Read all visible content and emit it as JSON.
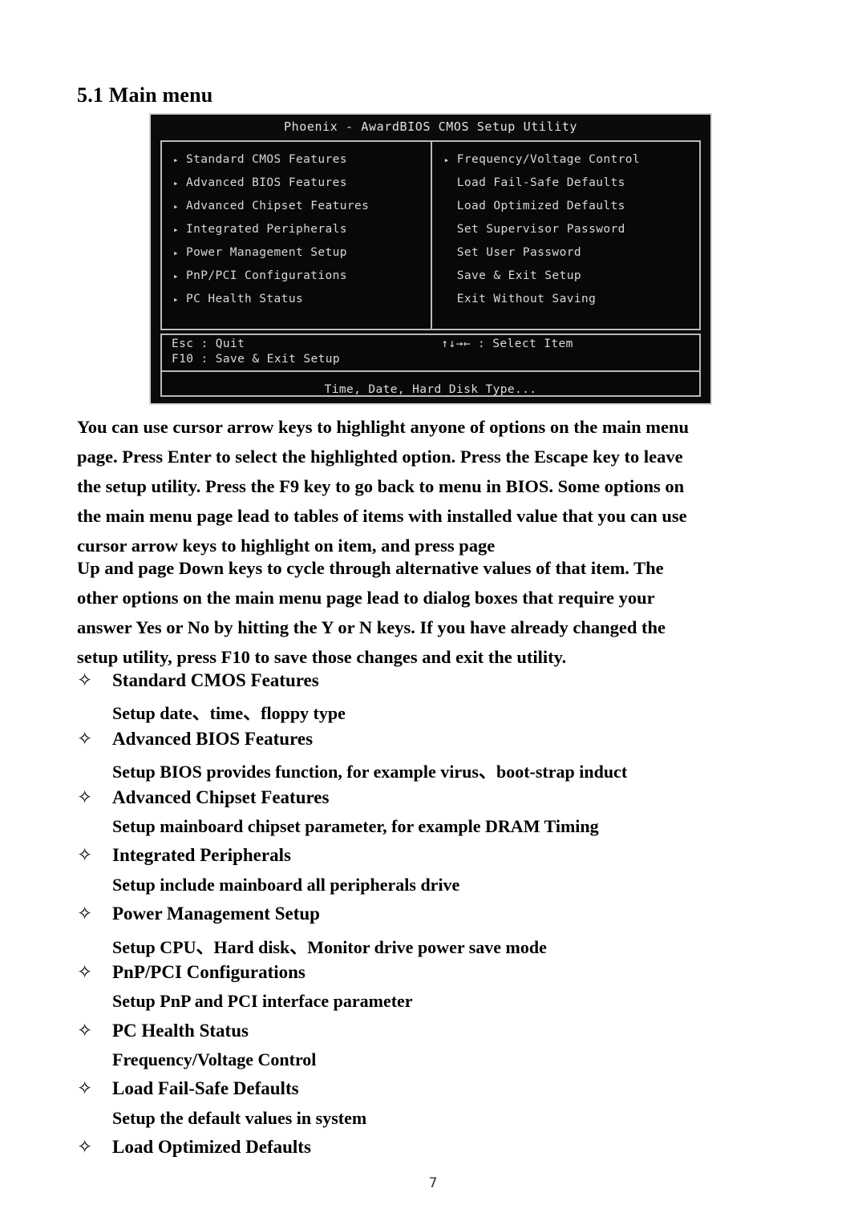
{
  "document": {
    "section_heading": "5.1 Main menu",
    "page_number": "7"
  },
  "bios_screenshot": {
    "title": "Phoenix - AwardBIOS CMOS Setup Utility",
    "arrow_glyph": "▸",
    "left_column": [
      {
        "label": "Standard CMOS Features",
        "has_arrow": true
      },
      {
        "label": "Advanced BIOS Features",
        "has_arrow": true
      },
      {
        "label": "Advanced Chipset Features",
        "has_arrow": true
      },
      {
        "label": "Integrated Peripherals",
        "has_arrow": true
      },
      {
        "label": "Power Management Setup",
        "has_arrow": true
      },
      {
        "label": "PnP/PCI Configurations",
        "has_arrow": true
      },
      {
        "label": "PC Health Status",
        "has_arrow": true
      }
    ],
    "right_column": [
      {
        "label": "Frequency/Voltage Control",
        "has_arrow": true
      },
      {
        "label": "Load Fail-Safe Defaults",
        "has_arrow": false
      },
      {
        "label": "Load Optimized Defaults",
        "has_arrow": false
      },
      {
        "label": "Set Supervisor Password",
        "has_arrow": false
      },
      {
        "label": "Set User Password",
        "has_arrow": false
      },
      {
        "label": "Save & Exit Setup",
        "has_arrow": false
      },
      {
        "label": "Exit Without Saving",
        "has_arrow": false
      }
    ],
    "key_hints": {
      "esc": "Esc : Quit",
      "f10": "F10 : Save & Exit Setup",
      "select": "↑↓→←   : Select Item"
    },
    "help_text": "Time, Date, Hard Disk Type..."
  },
  "body": {
    "paragraph_1": [
      "You can use cursor arrow keys to highlight anyone of options on the main menu",
      "page. Press Enter to select the highlighted option. Press the Escape key to leave",
      "the setup utility. Press the F9 key to go back to menu in BIOS. Some options on",
      "the main menu page lead to tables of items with installed value that you can use",
      "cursor arrow keys to highlight on item, and press page"
    ],
    "paragraph_2": [
      "Up and page Down keys to cycle through alternative values of that item. The",
      "other options on the main menu page lead to dialog boxes that require your",
      "answer Yes or No by hitting the Y or N keys. If you have already changed the",
      "setup utility, press F10 to save those changes and exit the utility."
    ]
  },
  "feature_list": {
    "bullet_glyph": "✧",
    "items": [
      {
        "label": "Standard CMOS Features",
        "description": "Setup date、time、floppy type"
      },
      {
        "label": "Advanced BIOS Features",
        "description": "Setup BIOS provides function, for example virus、boot-strap induct"
      },
      {
        "label": "Advanced Chipset Features",
        "description": "Setup mainboard chipset parameter, for example DRAM Timing"
      },
      {
        "label": "Integrated Peripherals",
        "description": "Setup include mainboard all peripherals drive"
      },
      {
        "label": "Power Management Setup",
        "description": "Setup CPU、Hard disk、Monitor drive power save mode"
      },
      {
        "label": "PnP/PCI Configurations",
        "description": "Setup PnP and PCI interface parameter"
      },
      {
        "label": "PC Health Status",
        "description": "Frequency/Voltage Control"
      },
      {
        "label": "Load Fail-Safe Defaults",
        "description": "Setup the default values in system"
      },
      {
        "label": "Load Optimized Defaults",
        "description": ""
      }
    ]
  }
}
